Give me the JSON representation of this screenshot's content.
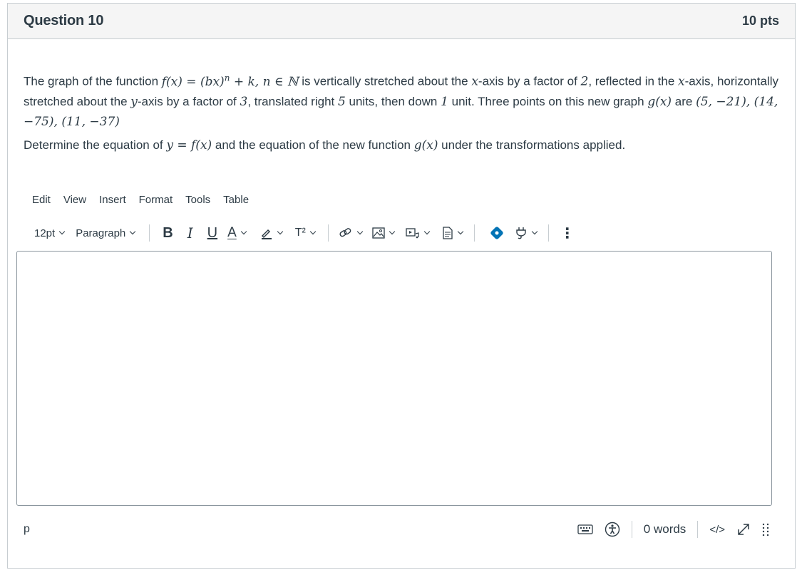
{
  "question": {
    "title": "Question 10",
    "points": "10 pts",
    "para1_parts": {
      "t1": "The graph of the function ",
      "m1": "f(x) = (bx)",
      "m1sup": "n",
      "m2": " + k, n ∈ ℕ",
      "t2": " is vertically stretched about the ",
      "x1": "x",
      "t3": "-axis by a factor of ",
      "n2": "2",
      "t4": ", reflected in the ",
      "x2": "x",
      "t5": "-axis, horizontally stretched about the ",
      "y1": "y",
      "t6": "-axis by a factor of ",
      "n3": "3",
      "t7": ", translated right ",
      "n5": "5",
      "t8": " units, then down ",
      "n1": "1",
      "t9": " unit. Three points on this new graph ",
      "g1": "g(x)",
      "t10": " are ",
      "pts": "(5, −21), (14, −75), (11, −37)"
    },
    "para2_parts": {
      "t1": "Determine the equation of ",
      "m1": "y = f(x)",
      "t2": " and the equation of the new function ",
      "m2": "g(x)",
      "t3": " under the transformations applied."
    }
  },
  "editor": {
    "menu": [
      "Edit",
      "View",
      "Insert",
      "Format",
      "Tools",
      "Table"
    ],
    "font_size": "12pt",
    "block_format": "Paragraph",
    "bold_label": "B",
    "italic_label": "I",
    "underline_label": "U",
    "text_color_label": "A",
    "superscript_label": "T²",
    "more_label": "⋮",
    "content": "",
    "path": "p",
    "word_count": "0 words",
    "html_label": "</>"
  },
  "colors": {
    "accent_blue": "#0374b5",
    "text": "#2d3b45",
    "border": "#c7cdd1"
  }
}
